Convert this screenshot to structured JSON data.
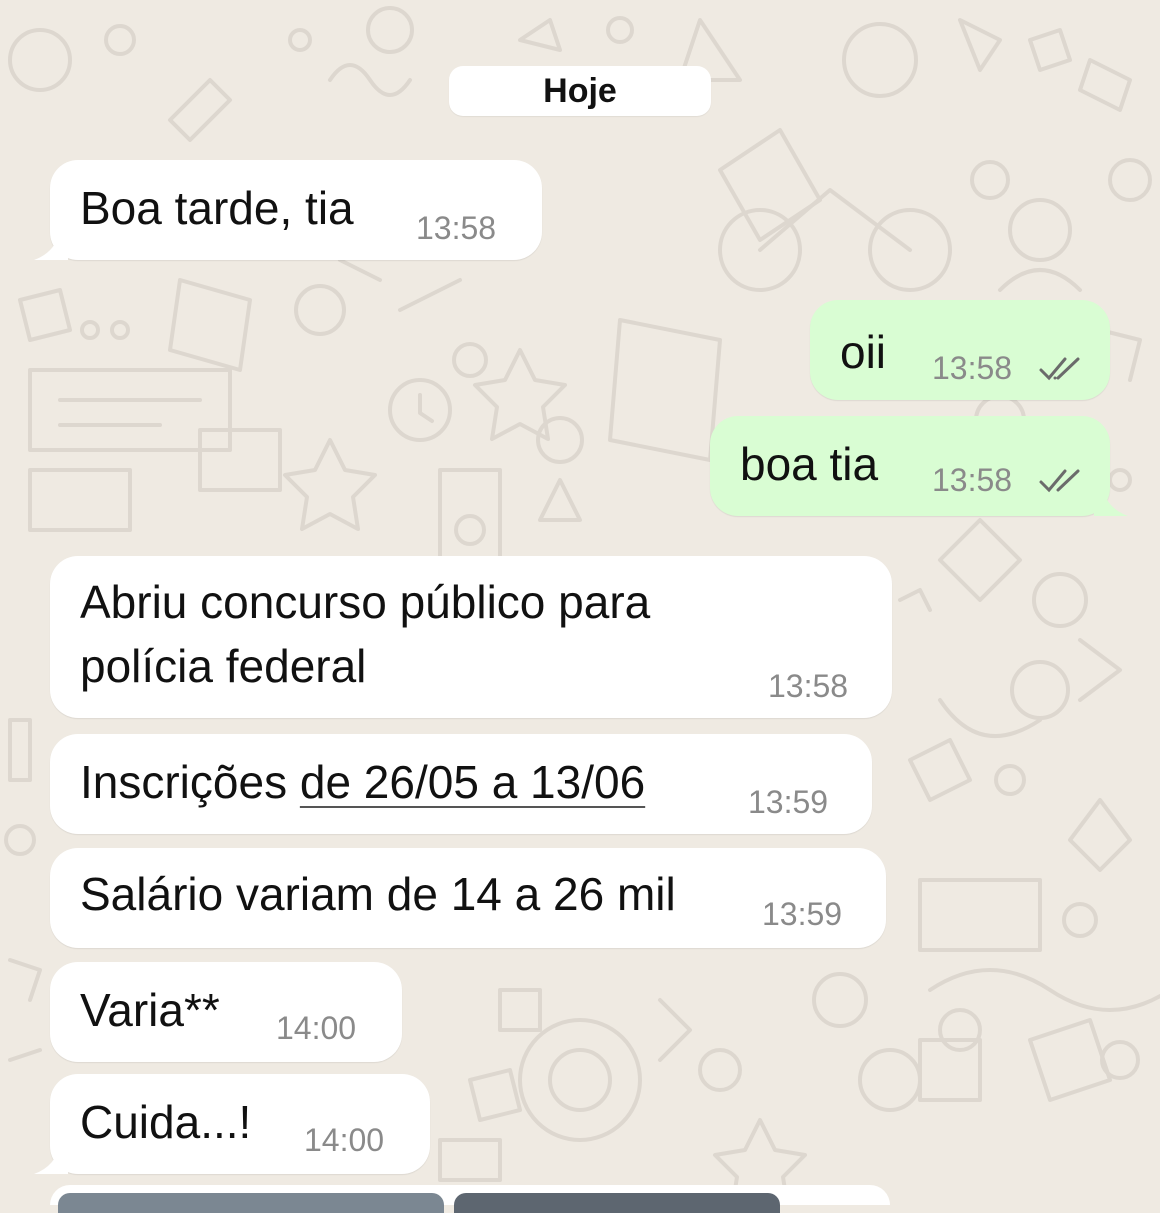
{
  "chat": {
    "date_separator": "Hoje",
    "messages": [
      {
        "direction": "incoming",
        "text": "Boa tarde, tia",
        "time": "13:58"
      },
      {
        "direction": "outgoing",
        "text": "oii",
        "time": "13:58",
        "status": "read-double-check-icon"
      },
      {
        "direction": "outgoing",
        "text": "boa tia",
        "time": "13:58",
        "status": "read-double-check-icon"
      },
      {
        "direction": "incoming",
        "text_line1": "Abriu concurso público para",
        "text_line2": "polícia federal",
        "time": "13:58"
      },
      {
        "direction": "incoming",
        "text_prefix": "Inscrições ",
        "text_link": "de 26/05 a 13/06",
        "time": "13:59"
      },
      {
        "direction": "incoming",
        "text": "Salário variam de 14 a 26 mil",
        "time": "13:59"
      },
      {
        "direction": "incoming",
        "text": "Varia**",
        "time": "14:00"
      },
      {
        "direction": "incoming",
        "text": "Cuida...!",
        "time": "14:00"
      }
    ]
  },
  "colors": {
    "wallpaper": "#efeae2",
    "incoming_bubble": "#ffffff",
    "outgoing_bubble": "#d9fdd3",
    "timestamp": "#8a8a8a",
    "read_ticks": "#6b6b6b"
  }
}
